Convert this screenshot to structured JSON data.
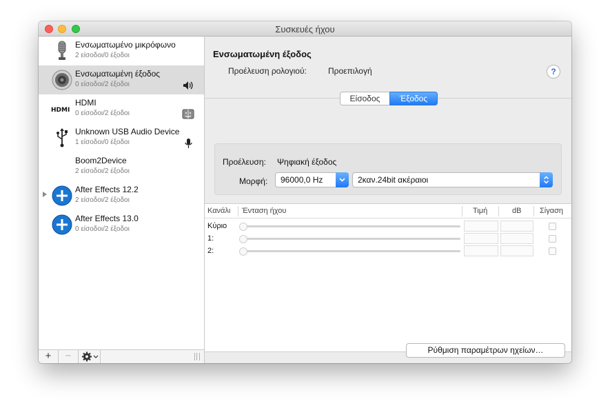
{
  "window": {
    "title": "Συσκευές ήχου"
  },
  "devices": [
    {
      "name": "Ενσωματωμένο μικρόφωνο",
      "io": "2 είσοδοι/0 έξοδοι",
      "icon": "microphone-icon"
    },
    {
      "name": "Ενσωματωμένη έξοδος",
      "io": "0 είσοδοι/2 έξοδοι",
      "icon": "speaker-icon",
      "selected": true,
      "badge": "speaker-badge-icon"
    },
    {
      "name": "HDMI",
      "io": "0 είσοδοι/2 έξοδοι",
      "icon": "hdmi-icon",
      "icon_text": "HDMI",
      "badge": "finder-badge-icon"
    },
    {
      "name": "Unknown USB Audio Device",
      "io": "1 είσοδοι/0 έξοδοι",
      "icon": "usb-icon",
      "badge": "mic-badge-icon"
    },
    {
      "name": "Boom2Device",
      "io": "2 είσοδοι/2 έξοδοι",
      "icon": ""
    },
    {
      "name": "After Effects 12.2",
      "io": "2 είσοδοι/2 έξοδοι",
      "icon": "aggregate-plus-icon",
      "expandable": true
    },
    {
      "name": "After Effects 13.0",
      "io": "0 είσοδοι/2 έξοδοι",
      "icon": "aggregate-plus-icon"
    }
  ],
  "sidebar_footer": {
    "add": "+",
    "remove": "−"
  },
  "detail": {
    "title": "Ενσωματωμένη έξοδος",
    "clock_label": "Προέλευση ρολογιού:",
    "clock_value": "Προεπιλογή",
    "help": "?",
    "tabs": [
      "Είσοδος",
      "Έξοδος"
    ],
    "active_tab": "Έξοδος",
    "source_label": "Προέλευση:",
    "source_value": "Ψηφιακή έξοδος",
    "format_label": "Μορφή:",
    "sample_rate": "96000,0 Hz",
    "format_value": "2καν.24bit ακέραιοι",
    "columns": {
      "channel": "Κανάλι",
      "volume": "Ένταση ήχου",
      "value": "Τιμή",
      "db": "dB",
      "mute": "Σίγαση"
    },
    "channels": [
      "Κύριο",
      "1:",
      "2:"
    ],
    "configure_button": "Ρύθμιση παραμέτρων ηχείων…"
  },
  "colors": {
    "accent": "#1f7bf5",
    "selection": "#dcdcdc",
    "plus_icon": "#1b76d3"
  }
}
